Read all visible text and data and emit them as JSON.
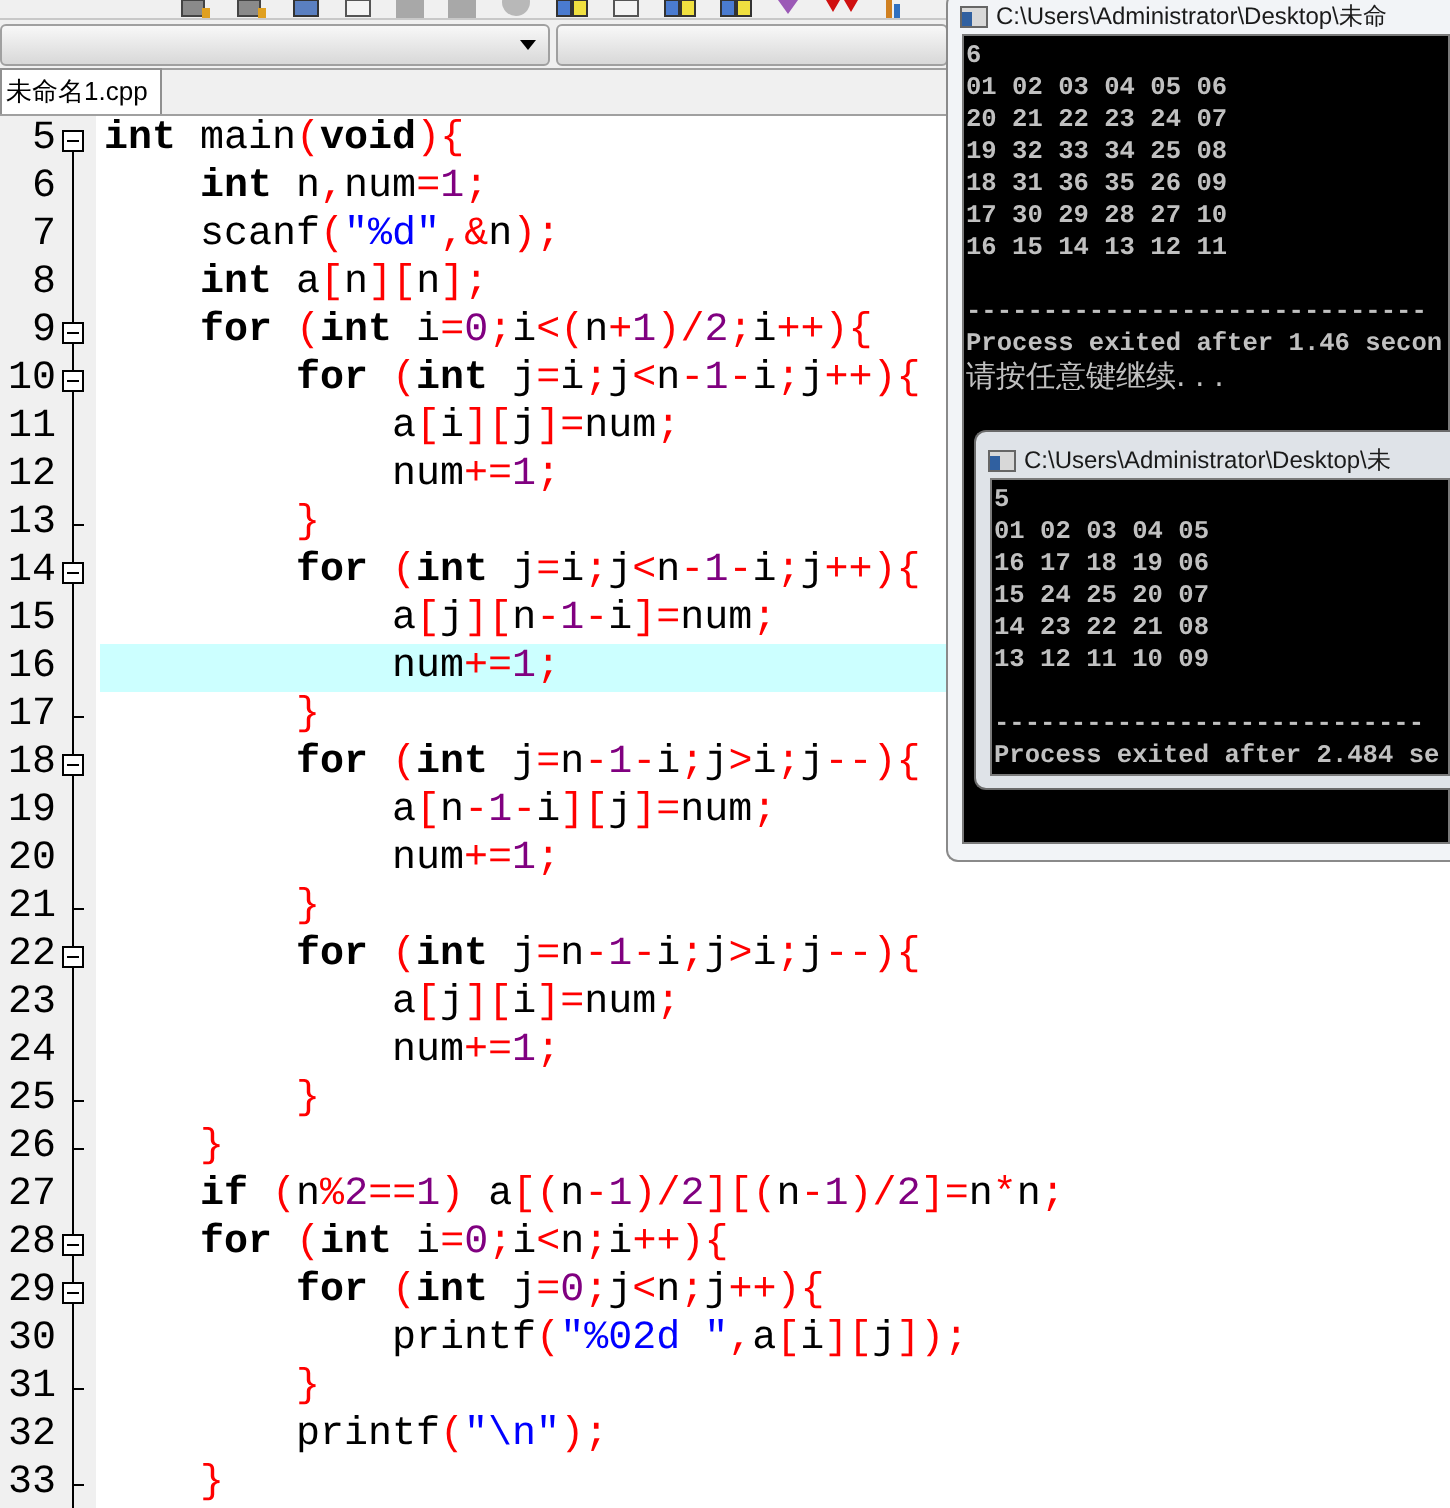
{
  "toolbar": {
    "icons": [
      {
        "kind": "disk"
      },
      {
        "kind": "disk"
      },
      {
        "kind": "window"
      },
      {
        "kind": "page"
      },
      {
        "kind": "stop"
      },
      {
        "kind": "stop"
      },
      {
        "kind": "circle"
      },
      {
        "kind": "grid"
      },
      {
        "kind": "page"
      },
      {
        "kind": "grid"
      },
      {
        "kind": "grid"
      },
      {
        "kind": "gem"
      },
      {
        "kind": "hearts"
      },
      {
        "kind": "chart"
      }
    ]
  },
  "tabs": [
    {
      "label": "未命名1.cpp",
      "selected": true
    }
  ],
  "editor": {
    "lines": [
      {
        "number": "5",
        "kind": "start",
        "highlighted": false,
        "segments": [
          {
            "kind": "keyword",
            "text": "int"
          },
          {
            "kind": "plain",
            "text": " main"
          },
          {
            "kind": "symbol",
            "text": "("
          },
          {
            "kind": "keyword",
            "text": "void"
          },
          {
            "kind": "symbol",
            "text": "){"
          }
        ]
      },
      {
        "number": "6",
        "kind": "body",
        "highlighted": false,
        "segments": [
          {
            "kind": "keyword",
            "text": "    int"
          },
          {
            "kind": "plain",
            "text": " n"
          },
          {
            "kind": "symbol",
            "text": ","
          },
          {
            "kind": "plain",
            "text": "num"
          },
          {
            "kind": "symbol",
            "text": "="
          },
          {
            "kind": "number",
            "text": "1"
          },
          {
            "kind": "symbol",
            "text": ";"
          }
        ]
      },
      {
        "number": "7",
        "kind": "body",
        "highlighted": false,
        "segments": [
          {
            "kind": "plain",
            "text": "    scanf"
          },
          {
            "kind": "symbol",
            "text": "("
          },
          {
            "kind": "string",
            "text": "\"%d\""
          },
          {
            "kind": "symbol",
            "text": ",&"
          },
          {
            "kind": "plain",
            "text": "n"
          },
          {
            "kind": "symbol",
            "text": ");"
          }
        ]
      },
      {
        "number": "8",
        "kind": "body",
        "highlighted": false,
        "segments": [
          {
            "kind": "keyword",
            "text": "    int"
          },
          {
            "kind": "plain",
            "text": " a"
          },
          {
            "kind": "symbol",
            "text": "["
          },
          {
            "kind": "plain",
            "text": "n"
          },
          {
            "kind": "symbol",
            "text": "]["
          },
          {
            "kind": "plain",
            "text": "n"
          },
          {
            "kind": "symbol",
            "text": "];"
          }
        ]
      },
      {
        "number": "9",
        "kind": "start",
        "highlighted": false,
        "segments": [
          {
            "kind": "keyword",
            "text": "    for"
          },
          {
            "kind": "symbol",
            "text": " ("
          },
          {
            "kind": "keyword",
            "text": "int"
          },
          {
            "kind": "plain",
            "text": " i"
          },
          {
            "kind": "symbol",
            "text": "="
          },
          {
            "kind": "number",
            "text": "0"
          },
          {
            "kind": "symbol",
            "text": ";"
          },
          {
            "kind": "plain",
            "text": "i"
          },
          {
            "kind": "symbol",
            "text": "<("
          },
          {
            "kind": "plain",
            "text": "n"
          },
          {
            "kind": "symbol",
            "text": "+"
          },
          {
            "kind": "number",
            "text": "1"
          },
          {
            "kind": "symbol",
            "text": ")/"
          },
          {
            "kind": "number",
            "text": "2"
          },
          {
            "kind": "symbol",
            "text": ";"
          },
          {
            "kind": "plain",
            "text": "i"
          },
          {
            "kind": "symbol",
            "text": "++){"
          }
        ]
      },
      {
        "number": "10",
        "kind": "start",
        "highlighted": false,
        "segments": [
          {
            "kind": "keyword",
            "text": "        for"
          },
          {
            "kind": "symbol",
            "text": " ("
          },
          {
            "kind": "keyword",
            "text": "int"
          },
          {
            "kind": "plain",
            "text": " j"
          },
          {
            "kind": "symbol",
            "text": "="
          },
          {
            "kind": "plain",
            "text": "i"
          },
          {
            "kind": "symbol",
            "text": ";"
          },
          {
            "kind": "plain",
            "text": "j"
          },
          {
            "kind": "symbol",
            "text": "<"
          },
          {
            "kind": "plain",
            "text": "n"
          },
          {
            "kind": "symbol",
            "text": "-"
          },
          {
            "kind": "number",
            "text": "1"
          },
          {
            "kind": "symbol",
            "text": "-"
          },
          {
            "kind": "plain",
            "text": "i"
          },
          {
            "kind": "symbol",
            "text": ";"
          },
          {
            "kind": "plain",
            "text": "j"
          },
          {
            "kind": "symbol",
            "text": "++){"
          }
        ]
      },
      {
        "number": "11",
        "kind": "body",
        "highlighted": false,
        "segments": [
          {
            "kind": "plain",
            "text": "            a"
          },
          {
            "kind": "symbol",
            "text": "["
          },
          {
            "kind": "plain",
            "text": "i"
          },
          {
            "kind": "symbol",
            "text": "]["
          },
          {
            "kind": "plain",
            "text": "j"
          },
          {
            "kind": "symbol",
            "text": "]="
          },
          {
            "kind": "plain",
            "text": "num"
          },
          {
            "kind": "symbol",
            "text": ";"
          }
        ]
      },
      {
        "number": "12",
        "kind": "body",
        "highlighted": false,
        "segments": [
          {
            "kind": "plain",
            "text": "            num"
          },
          {
            "kind": "symbol",
            "text": "+="
          },
          {
            "kind": "number",
            "text": "1"
          },
          {
            "kind": "symbol",
            "text": ";"
          }
        ]
      },
      {
        "number": "13",
        "kind": "end",
        "highlighted": false,
        "segments": [
          {
            "kind": "symbol",
            "text": "        }"
          }
        ]
      },
      {
        "number": "14",
        "kind": "start",
        "highlighted": false,
        "segments": [
          {
            "kind": "keyword",
            "text": "        for"
          },
          {
            "kind": "symbol",
            "text": " ("
          },
          {
            "kind": "keyword",
            "text": "int"
          },
          {
            "kind": "plain",
            "text": " j"
          },
          {
            "kind": "symbol",
            "text": "="
          },
          {
            "kind": "plain",
            "text": "i"
          },
          {
            "kind": "symbol",
            "text": ";"
          },
          {
            "kind": "plain",
            "text": "j"
          },
          {
            "kind": "symbol",
            "text": "<"
          },
          {
            "kind": "plain",
            "text": "n"
          },
          {
            "kind": "symbol",
            "text": "-"
          },
          {
            "kind": "number",
            "text": "1"
          },
          {
            "kind": "symbol",
            "text": "-"
          },
          {
            "kind": "plain",
            "text": "i"
          },
          {
            "kind": "symbol",
            "text": ";"
          },
          {
            "kind": "plain",
            "text": "j"
          },
          {
            "kind": "symbol",
            "text": "++){"
          }
        ]
      },
      {
        "number": "15",
        "kind": "body",
        "highlighted": false,
        "segments": [
          {
            "kind": "plain",
            "text": "            a"
          },
          {
            "kind": "symbol",
            "text": "["
          },
          {
            "kind": "plain",
            "text": "j"
          },
          {
            "kind": "symbol",
            "text": "]["
          },
          {
            "kind": "plain",
            "text": "n"
          },
          {
            "kind": "symbol",
            "text": "-"
          },
          {
            "kind": "number",
            "text": "1"
          },
          {
            "kind": "symbol",
            "text": "-"
          },
          {
            "kind": "plain",
            "text": "i"
          },
          {
            "kind": "symbol",
            "text": "]="
          },
          {
            "kind": "plain",
            "text": "num"
          },
          {
            "kind": "symbol",
            "text": ";"
          }
        ]
      },
      {
        "number": "16",
        "kind": "body",
        "highlighted": true,
        "segments": [
          {
            "kind": "plain",
            "text": "            num"
          },
          {
            "kind": "symbol",
            "text": "+="
          },
          {
            "kind": "number",
            "text": "1"
          },
          {
            "kind": "symbol",
            "text": ";"
          }
        ]
      },
      {
        "number": "17",
        "kind": "end",
        "highlighted": false,
        "segments": [
          {
            "kind": "symbol",
            "text": "        }"
          }
        ]
      },
      {
        "number": "18",
        "kind": "start",
        "highlighted": false,
        "segments": [
          {
            "kind": "keyword",
            "text": "        for"
          },
          {
            "kind": "symbol",
            "text": " ("
          },
          {
            "kind": "keyword",
            "text": "int"
          },
          {
            "kind": "plain",
            "text": " j"
          },
          {
            "kind": "symbol",
            "text": "="
          },
          {
            "kind": "plain",
            "text": "n"
          },
          {
            "kind": "symbol",
            "text": "-"
          },
          {
            "kind": "number",
            "text": "1"
          },
          {
            "kind": "symbol",
            "text": "-"
          },
          {
            "kind": "plain",
            "text": "i"
          },
          {
            "kind": "symbol",
            "text": ";"
          },
          {
            "kind": "plain",
            "text": "j"
          },
          {
            "kind": "symbol",
            "text": ">"
          },
          {
            "kind": "plain",
            "text": "i"
          },
          {
            "kind": "symbol",
            "text": ";"
          },
          {
            "kind": "plain",
            "text": "j"
          },
          {
            "kind": "symbol",
            "text": "--){"
          }
        ]
      },
      {
        "number": "19",
        "kind": "body",
        "highlighted": false,
        "segments": [
          {
            "kind": "plain",
            "text": "            a"
          },
          {
            "kind": "symbol",
            "text": "["
          },
          {
            "kind": "plain",
            "text": "n"
          },
          {
            "kind": "symbol",
            "text": "-"
          },
          {
            "kind": "number",
            "text": "1"
          },
          {
            "kind": "symbol",
            "text": "-"
          },
          {
            "kind": "plain",
            "text": "i"
          },
          {
            "kind": "symbol",
            "text": "]["
          },
          {
            "kind": "plain",
            "text": "j"
          },
          {
            "kind": "symbol",
            "text": "]="
          },
          {
            "kind": "plain",
            "text": "num"
          },
          {
            "kind": "symbol",
            "text": ";"
          }
        ]
      },
      {
        "number": "20",
        "kind": "body",
        "highlighted": false,
        "segments": [
          {
            "kind": "plain",
            "text": "            num"
          },
          {
            "kind": "symbol",
            "text": "+="
          },
          {
            "kind": "number",
            "text": "1"
          },
          {
            "kind": "symbol",
            "text": ";"
          }
        ]
      },
      {
        "number": "21",
        "kind": "end",
        "highlighted": false,
        "segments": [
          {
            "kind": "symbol",
            "text": "        }"
          }
        ]
      },
      {
        "number": "22",
        "kind": "start",
        "highlighted": false,
        "segments": [
          {
            "kind": "keyword",
            "text": "        for"
          },
          {
            "kind": "symbol",
            "text": " ("
          },
          {
            "kind": "keyword",
            "text": "int"
          },
          {
            "kind": "plain",
            "text": " j"
          },
          {
            "kind": "symbol",
            "text": "="
          },
          {
            "kind": "plain",
            "text": "n"
          },
          {
            "kind": "symbol",
            "text": "-"
          },
          {
            "kind": "number",
            "text": "1"
          },
          {
            "kind": "symbol",
            "text": "-"
          },
          {
            "kind": "plain",
            "text": "i"
          },
          {
            "kind": "symbol",
            "text": ";"
          },
          {
            "kind": "plain",
            "text": "j"
          },
          {
            "kind": "symbol",
            "text": ">"
          },
          {
            "kind": "plain",
            "text": "i"
          },
          {
            "kind": "symbol",
            "text": ";"
          },
          {
            "kind": "plain",
            "text": "j"
          },
          {
            "kind": "symbol",
            "text": "--){"
          }
        ]
      },
      {
        "number": "23",
        "kind": "body",
        "highlighted": false,
        "segments": [
          {
            "kind": "plain",
            "text": "            a"
          },
          {
            "kind": "symbol",
            "text": "["
          },
          {
            "kind": "plain",
            "text": "j"
          },
          {
            "kind": "symbol",
            "text": "]["
          },
          {
            "kind": "plain",
            "text": "i"
          },
          {
            "kind": "symbol",
            "text": "]="
          },
          {
            "kind": "plain",
            "text": "num"
          },
          {
            "kind": "symbol",
            "text": ";"
          }
        ]
      },
      {
        "number": "24",
        "kind": "body",
        "highlighted": false,
        "segments": [
          {
            "kind": "plain",
            "text": "            num"
          },
          {
            "kind": "symbol",
            "text": "+="
          },
          {
            "kind": "number",
            "text": "1"
          },
          {
            "kind": "symbol",
            "text": ";"
          }
        ]
      },
      {
        "number": "25",
        "kind": "end",
        "highlighted": false,
        "segments": [
          {
            "kind": "symbol",
            "text": "        }"
          }
        ]
      },
      {
        "number": "26",
        "kind": "end",
        "highlighted": false,
        "segments": [
          {
            "kind": "symbol",
            "text": "    }"
          }
        ]
      },
      {
        "number": "27",
        "kind": "body",
        "highlighted": false,
        "segments": [
          {
            "kind": "keyword",
            "text": "    if"
          },
          {
            "kind": "symbol",
            "text": " ("
          },
          {
            "kind": "plain",
            "text": "n"
          },
          {
            "kind": "symbol",
            "text": "%"
          },
          {
            "kind": "number",
            "text": "2"
          },
          {
            "kind": "symbol",
            "text": "=="
          },
          {
            "kind": "number",
            "text": "1"
          },
          {
            "kind": "symbol",
            "text": ")"
          },
          {
            "kind": "plain",
            "text": " a"
          },
          {
            "kind": "symbol",
            "text": "[("
          },
          {
            "kind": "plain",
            "text": "n"
          },
          {
            "kind": "symbol",
            "text": "-"
          },
          {
            "kind": "number",
            "text": "1"
          },
          {
            "kind": "symbol",
            "text": ")/"
          },
          {
            "kind": "number",
            "text": "2"
          },
          {
            "kind": "symbol",
            "text": "][("
          },
          {
            "kind": "plain",
            "text": "n"
          },
          {
            "kind": "symbol",
            "text": "-"
          },
          {
            "kind": "number",
            "text": "1"
          },
          {
            "kind": "symbol",
            "text": ")/"
          },
          {
            "kind": "number",
            "text": "2"
          },
          {
            "kind": "symbol",
            "text": "]="
          },
          {
            "kind": "plain",
            "text": "n"
          },
          {
            "kind": "symbol",
            "text": "*"
          },
          {
            "kind": "plain",
            "text": "n"
          },
          {
            "kind": "symbol",
            "text": ";"
          }
        ]
      },
      {
        "number": "28",
        "kind": "start",
        "highlighted": false,
        "segments": [
          {
            "kind": "keyword",
            "text": "    for"
          },
          {
            "kind": "symbol",
            "text": " ("
          },
          {
            "kind": "keyword",
            "text": "int"
          },
          {
            "kind": "plain",
            "text": " i"
          },
          {
            "kind": "symbol",
            "text": "="
          },
          {
            "kind": "number",
            "text": "0"
          },
          {
            "kind": "symbol",
            "text": ";"
          },
          {
            "kind": "plain",
            "text": "i"
          },
          {
            "kind": "symbol",
            "text": "<"
          },
          {
            "kind": "plain",
            "text": "n"
          },
          {
            "kind": "symbol",
            "text": ";"
          },
          {
            "kind": "plain",
            "text": "i"
          },
          {
            "kind": "symbol",
            "text": "++){"
          }
        ]
      },
      {
        "number": "29",
        "kind": "start",
        "highlighted": false,
        "segments": [
          {
            "kind": "keyword",
            "text": "        for"
          },
          {
            "kind": "symbol",
            "text": " ("
          },
          {
            "kind": "keyword",
            "text": "int"
          },
          {
            "kind": "plain",
            "text": " j"
          },
          {
            "kind": "symbol",
            "text": "="
          },
          {
            "kind": "number",
            "text": "0"
          },
          {
            "kind": "symbol",
            "text": ";"
          },
          {
            "kind": "plain",
            "text": "j"
          },
          {
            "kind": "symbol",
            "text": "<"
          },
          {
            "kind": "plain",
            "text": "n"
          },
          {
            "kind": "symbol",
            "text": ";"
          },
          {
            "kind": "plain",
            "text": "j"
          },
          {
            "kind": "symbol",
            "text": "++){"
          }
        ]
      },
      {
        "number": "30",
        "kind": "body",
        "highlighted": false,
        "segments": [
          {
            "kind": "plain",
            "text": "            printf"
          },
          {
            "kind": "symbol",
            "text": "("
          },
          {
            "kind": "string",
            "text": "\"%02d \""
          },
          {
            "kind": "symbol",
            "text": ","
          },
          {
            "kind": "plain",
            "text": "a"
          },
          {
            "kind": "symbol",
            "text": "["
          },
          {
            "kind": "plain",
            "text": "i"
          },
          {
            "kind": "symbol",
            "text": "]["
          },
          {
            "kind": "plain",
            "text": "j"
          },
          {
            "kind": "symbol",
            "text": "]);"
          }
        ]
      },
      {
        "number": "31",
        "kind": "end",
        "highlighted": false,
        "segments": [
          {
            "kind": "symbol",
            "text": "        }"
          }
        ]
      },
      {
        "number": "32",
        "kind": "body",
        "highlighted": false,
        "segments": [
          {
            "kind": "plain",
            "text": "        printf"
          },
          {
            "kind": "symbol",
            "text": "("
          },
          {
            "kind": "string",
            "text": "\"\\n\""
          },
          {
            "kind": "symbol",
            "text": ");"
          }
        ]
      },
      {
        "number": "33",
        "kind": "end",
        "highlighted": false,
        "segments": [
          {
            "kind": "symbol",
            "text": "    }"
          }
        ]
      }
    ]
  },
  "console_windows": [
    {
      "title": "C:\\Users\\Administrator\\Desktop\\未命",
      "input": "6",
      "rows": [
        "01 02 03 04 05 06",
        "20 21 22 23 24 07",
        "19 32 33 34 25 08",
        "18 31 36 35 26 09",
        "17 30 29 28 27 10",
        "16 15 14 13 12 11"
      ],
      "separator": "------------------------------",
      "status": "Process exited after 1.46 secon",
      "prompt": "请按任意键继续. . ."
    },
    {
      "title": "C:\\Users\\Administrator\\Desktop\\未",
      "input": "5",
      "rows": [
        "01 02 03 04 05",
        "16 17 18 19 06",
        "15 24 25 20 07",
        "14 23 22 21 08",
        "13 12 11 10 09"
      ],
      "separator": "----------------------------",
      "status": "Process exited after 2.484 se"
    }
  ]
}
